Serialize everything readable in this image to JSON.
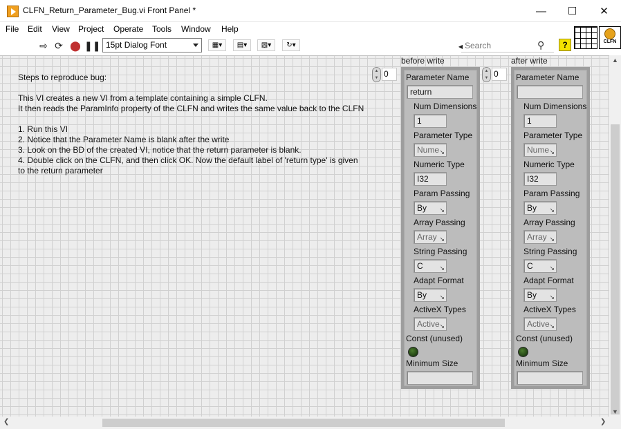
{
  "window": {
    "title": "CLFN_Return_Parameter_Bug.vi Front Panel *"
  },
  "menu": [
    "File",
    "Edit",
    "View",
    "Project",
    "Operate",
    "Tools",
    "Window",
    "Help"
  ],
  "toolbar": {
    "font": "15pt Dialog Font",
    "search_placeholder": "Search"
  },
  "vi_icon_text": "CLFN",
  "steps": [
    "Steps to reproduce bug:",
    "",
    "This VI creates a new VI from a template containing a simple CLFN.",
    "It then reads the ParamInfo property of the CLFN and writes the same value back to the CLFN",
    "",
    "1.  Run this VI",
    "2.  Notice that the Parameter Name is blank after the write",
    "3.  Look on the BD of the created VI, notice that the return parameter is blank.",
    "4.  Double click on the CLFN, and then click OK.  Now the default label of 'return type' is given",
    "to the return parameter"
  ],
  "clusters": [
    {
      "label": "before write",
      "index": "0",
      "param_name_label": "Parameter Name",
      "param_name": "return",
      "num_dim_label": "Num Dimensions",
      "num_dim": "1",
      "param_type_label": "Parameter Type",
      "param_type": "Nume",
      "numeric_type_label": "Numeric Type",
      "numeric_type": "I32",
      "param_passing_label": "Param Passing",
      "param_passing": "By",
      "array_passing_label": "Array Passing",
      "array_passing": "Array",
      "string_passing_label": "String Passing",
      "string_passing": "C",
      "adapt_format_label": "Adapt Format",
      "adapt_format": "By",
      "activex_label": "ActiveX Types",
      "activex": "Active",
      "const_label": "Const (unused)",
      "min_size_label": "Minimum Size",
      "min_size": ""
    },
    {
      "label": "after write",
      "index": "0",
      "param_name_label": "Parameter Name",
      "param_name": "",
      "num_dim_label": "Num Dimensions",
      "num_dim": "1",
      "param_type_label": "Parameter Type",
      "param_type": "Nume",
      "numeric_type_label": "Numeric Type",
      "numeric_type": "I32",
      "param_passing_label": "Param Passing",
      "param_passing": "By",
      "array_passing_label": "Array Passing",
      "array_passing": "Array",
      "string_passing_label": "String Passing",
      "string_passing": "C",
      "adapt_format_label": "Adapt Format",
      "adapt_format": "By",
      "activex_label": "ActiveX Types",
      "activex": "Active",
      "const_label": "Const (unused)",
      "min_size_label": "Minimum Size",
      "min_size": ""
    }
  ]
}
